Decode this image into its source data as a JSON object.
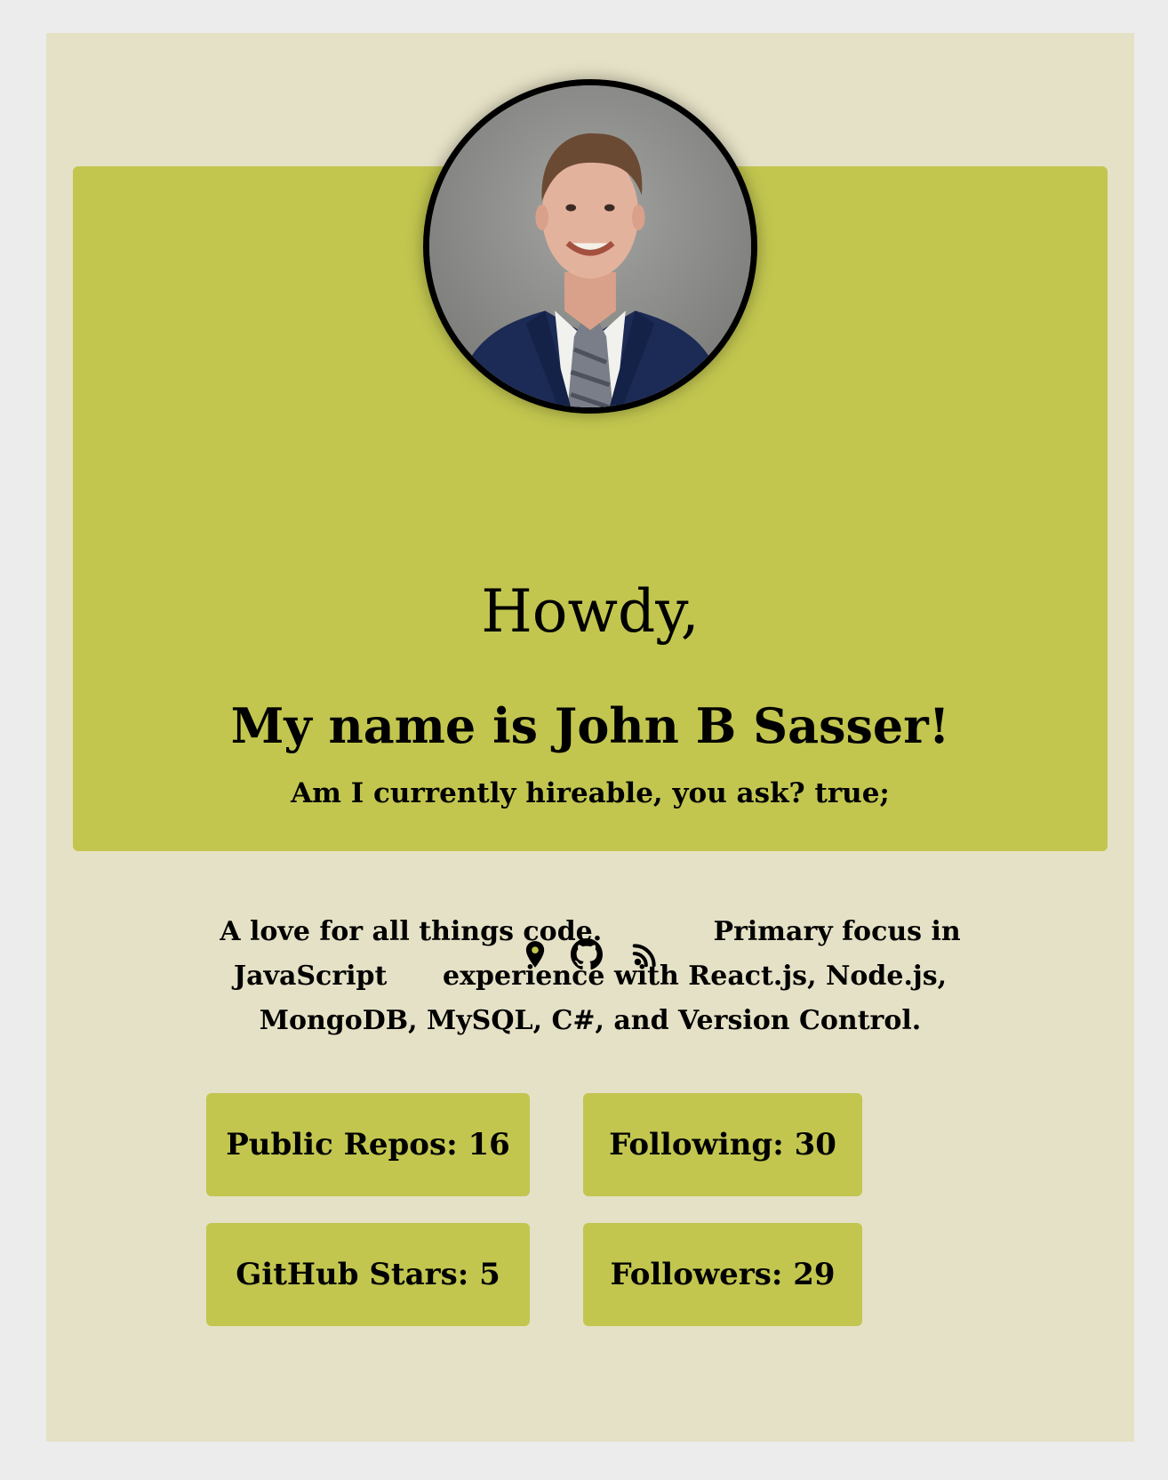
{
  "hero": {
    "greeting": "Howdy,",
    "name_line": "My name is John B Sasser!",
    "hireable_line": "Am I currently hireable, you ask? true;"
  },
  "links": {
    "location_icon": "location-pin-icon",
    "github_icon": "github-icon",
    "blog_icon": "rss-feed-icon"
  },
  "bio": {
    "line1": "A love for all things code.            Primary focus in",
    "line2": "JavaScript      experience with React.js, Node.js,",
    "line3": "MongoDB, MySQL, C#, and Version Control."
  },
  "stats": {
    "public_repos": "Public Repos: 16",
    "following": "Following: 30",
    "github_stars": "GitHub Stars: 5",
    "followers": "Followers: 29"
  },
  "colors": {
    "page_background": "#ececec",
    "panel_background": "#e5e1c6",
    "accent": "#c2c64f",
    "text": "#000000"
  }
}
